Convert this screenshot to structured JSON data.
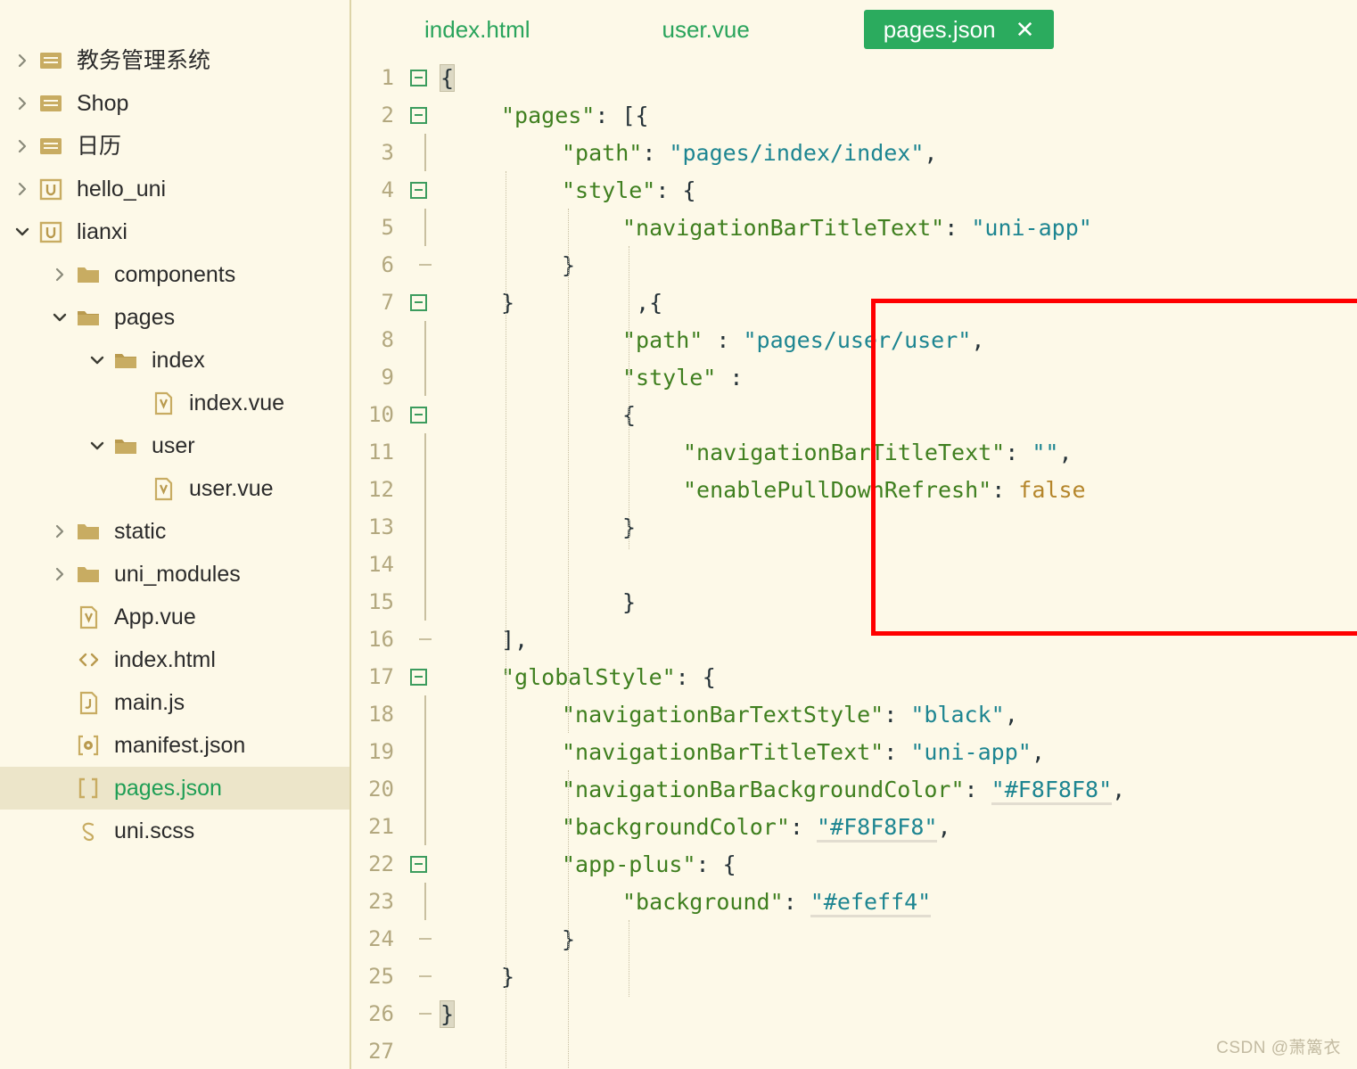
{
  "theme": {
    "background": "#fdf9e8",
    "accent_green": "#2bab5e",
    "selected_row": "#ece5c9",
    "key_color": "#3f7f1f",
    "string_color": "#1d8591",
    "boolean_color": "#b5862b",
    "line_number_color": "#b3a87f",
    "annotation_box_color": "#ff0000",
    "divider_color": "#ddd4a8"
  },
  "sidebar": {
    "items": [
      {
        "label": "教务管理系统",
        "icon": "folder-closed-icon",
        "twisty": "chevron-right",
        "depth": 0,
        "selected": false
      },
      {
        "label": "Shop",
        "icon": "folder-closed-icon",
        "twisty": "chevron-right",
        "depth": 0,
        "selected": false
      },
      {
        "label": "日历",
        "icon": "folder-closed-icon",
        "twisty": "chevron-right",
        "depth": 0,
        "selected": false
      },
      {
        "label": "hello_uni",
        "icon": "uniapp-project-icon",
        "twisty": "chevron-right",
        "depth": 0,
        "selected": false
      },
      {
        "label": "lianxi",
        "icon": "uniapp-project-icon",
        "twisty": "chevron-down",
        "depth": 0,
        "selected": false
      },
      {
        "label": "components",
        "icon": "folder-icon",
        "twisty": "chevron-right",
        "depth": 1,
        "selected": false
      },
      {
        "label": "pages",
        "icon": "folder-open-icon",
        "twisty": "chevron-down",
        "depth": 1,
        "selected": false
      },
      {
        "label": "index",
        "icon": "folder-open-icon",
        "twisty": "chevron-down",
        "depth": 2,
        "selected": false
      },
      {
        "label": "index.vue",
        "icon": "vue-file-icon",
        "twisty": "none",
        "depth": 3,
        "selected": false
      },
      {
        "label": "user",
        "icon": "folder-open-icon",
        "twisty": "chevron-down",
        "depth": 2,
        "selected": false
      },
      {
        "label": "user.vue",
        "icon": "vue-file-icon",
        "twisty": "none",
        "depth": 3,
        "selected": false
      },
      {
        "label": "static",
        "icon": "folder-icon",
        "twisty": "chevron-right",
        "depth": 1,
        "selected": false
      },
      {
        "label": "uni_modules",
        "icon": "folder-icon",
        "twisty": "chevron-right",
        "depth": 1,
        "selected": false
      },
      {
        "label": "App.vue",
        "icon": "vue-file-icon",
        "twisty": "none",
        "depth": 1,
        "selected": false
      },
      {
        "label": "index.html",
        "icon": "html-file-icon",
        "twisty": "none",
        "depth": 1,
        "selected": false
      },
      {
        "label": "main.js",
        "icon": "js-file-icon",
        "twisty": "none",
        "depth": 1,
        "selected": false
      },
      {
        "label": "manifest.json",
        "icon": "manifest-file-icon",
        "twisty": "none",
        "depth": 1,
        "selected": false
      },
      {
        "label": "pages.json",
        "icon": "json-file-icon",
        "twisty": "none",
        "depth": 1,
        "selected": true
      },
      {
        "label": "uni.scss",
        "icon": "scss-file-icon",
        "twisty": "none",
        "depth": 1,
        "selected": false
      }
    ]
  },
  "tabs": [
    {
      "label": "index.html",
      "active": false,
      "closable": false
    },
    {
      "label": "user.vue",
      "active": false,
      "closable": false
    },
    {
      "label": "pages.json",
      "active": true,
      "closable": true,
      "close_label": "✕"
    }
  ],
  "editor": {
    "language": "json",
    "filename": "pages.json",
    "lines": [
      {
        "n": "1",
        "fold": "box",
        "indent": 0,
        "tokens": [
          {
            "t": "{",
            "c": "p",
            "hl": true
          }
        ]
      },
      {
        "n": "2",
        "fold": "box",
        "indent": 1,
        "tokens": [
          {
            "t": "\"pages\"",
            "c": "k"
          },
          {
            "t": ": [{",
            "c": "p"
          }
        ]
      },
      {
        "n": "3",
        "fold": "bar",
        "indent": 2,
        "tokens": [
          {
            "t": "\"path\"",
            "c": "k"
          },
          {
            "t": ": ",
            "c": "p"
          },
          {
            "t": "\"pages/index/index\"",
            "c": "s"
          },
          {
            "t": ",",
            "c": "p"
          }
        ]
      },
      {
        "n": "4",
        "fold": "box",
        "indent": 2,
        "tokens": [
          {
            "t": "\"style\"",
            "c": "k"
          },
          {
            "t": ": {",
            "c": "p"
          }
        ]
      },
      {
        "n": "5",
        "fold": "bar",
        "indent": 3,
        "tokens": [
          {
            "t": "\"navigationBarTitleText\"",
            "c": "k"
          },
          {
            "t": ": ",
            "c": "p"
          },
          {
            "t": "\"uni-app\"",
            "c": "s"
          }
        ]
      },
      {
        "n": "6",
        "fold": "end",
        "indent": 2,
        "tokens": [
          {
            "t": "}",
            "c": "p"
          }
        ]
      },
      {
        "n": "7",
        "fold": "box",
        "indent": 1,
        "tokens": [
          {
            "t": "}",
            "c": "p"
          }
        ]
      },
      {
        "n": "8",
        "fold": "bar",
        "indent": 0,
        "tokens": []
      },
      {
        "n": "9",
        "fold": "bar",
        "indent": 0,
        "tokens": []
      },
      {
        "n": "10",
        "fold": "box",
        "indent": 0,
        "tokens": []
      },
      {
        "n": "11",
        "fold": "bar",
        "indent": 0,
        "tokens": []
      },
      {
        "n": "12",
        "fold": "bar",
        "indent": 0,
        "tokens": []
      },
      {
        "n": "13",
        "fold": "bar",
        "indent": 0,
        "tokens": []
      },
      {
        "n": "14",
        "fold": "bar",
        "indent": 0,
        "tokens": []
      },
      {
        "n": "15",
        "fold": "bar",
        "indent": 0,
        "tokens": []
      },
      {
        "n": "16",
        "fold": "end",
        "indent": 1,
        "tokens": [
          {
            "t": "],",
            "c": "p"
          }
        ]
      },
      {
        "n": "17",
        "fold": "box",
        "indent": 1,
        "tokens": [
          {
            "t": "\"globalStyle\"",
            "c": "k"
          },
          {
            "t": ": {",
            "c": "p"
          }
        ]
      },
      {
        "n": "18",
        "fold": "bar",
        "indent": 2,
        "tokens": [
          {
            "t": "\"navigationBarTextStyle\"",
            "c": "k"
          },
          {
            "t": ": ",
            "c": "p"
          },
          {
            "t": "\"black\"",
            "c": "s"
          },
          {
            "t": ",",
            "c": "p"
          }
        ]
      },
      {
        "n": "19",
        "fold": "bar",
        "indent": 2,
        "tokens": [
          {
            "t": "\"navigationBarTitleText\"",
            "c": "k"
          },
          {
            "t": ": ",
            "c": "p"
          },
          {
            "t": "\"uni-app\"",
            "c": "s"
          },
          {
            "t": ",",
            "c": "p"
          }
        ]
      },
      {
        "n": "20",
        "fold": "bar",
        "indent": 2,
        "tokens": [
          {
            "t": "\"navigationBarBackgroundColor\"",
            "c": "k"
          },
          {
            "t": ": ",
            "c": "p"
          },
          {
            "t": "\"#F8F8F8\"",
            "c": "hexv"
          },
          {
            "t": ",",
            "c": "p"
          }
        ]
      },
      {
        "n": "21",
        "fold": "bar",
        "indent": 2,
        "tokens": [
          {
            "t": "\"backgroundColor\"",
            "c": "k"
          },
          {
            "t": ": ",
            "c": "p"
          },
          {
            "t": "\"#F8F8F8\"",
            "c": "hexv"
          },
          {
            "t": ",",
            "c": "p"
          }
        ]
      },
      {
        "n": "22",
        "fold": "box",
        "indent": 2,
        "tokens": [
          {
            "t": "\"app-plus\"",
            "c": "k"
          },
          {
            "t": ": {",
            "c": "p"
          }
        ]
      },
      {
        "n": "23",
        "fold": "bar",
        "indent": 3,
        "tokens": [
          {
            "t": "\"background\"",
            "c": "k"
          },
          {
            "t": ": ",
            "c": "p"
          },
          {
            "t": "\"#efeff4\"",
            "c": "hexv"
          }
        ]
      },
      {
        "n": "24",
        "fold": "end",
        "indent": 2,
        "tokens": [
          {
            "t": "}",
            "c": "p"
          }
        ]
      },
      {
        "n": "25",
        "fold": "end",
        "indent": 1,
        "tokens": [
          {
            "t": "}",
            "c": "p"
          }
        ]
      },
      {
        "n": "26",
        "fold": "end",
        "indent": 0,
        "tokens": [
          {
            "t": "}",
            "c": "p",
            "hl": true
          }
        ]
      },
      {
        "n": "27",
        "fold": "none",
        "indent": 0,
        "tokens": []
      }
    ],
    "highlighted_block": {
      "lines": [
        {
          "n": "7",
          "indent": 2,
          "tokens": [
            {
              "t": ",{",
              "c": "p"
            }
          ]
        },
        {
          "n": "8",
          "indent": 3,
          "tokens": [
            {
              "t": "\"path\"",
              "c": "k"
            },
            {
              "t": " : ",
              "c": "p"
            },
            {
              "t": "\"pages/user/user\"",
              "c": "s"
            },
            {
              "t": ",",
              "c": "p"
            }
          ]
        },
        {
          "n": "9",
          "indent": 3,
          "tokens": [
            {
              "t": "\"style\"",
              "c": "k"
            },
            {
              "t": " :",
              "c": "p"
            }
          ]
        },
        {
          "n": "10",
          "indent": 3,
          "tokens": [
            {
              "t": "{",
              "c": "p"
            }
          ]
        },
        {
          "n": "11",
          "indent": 4,
          "tokens": [
            {
              "t": "\"navigationBarTitleText\"",
              "c": "k"
            },
            {
              "t": ": ",
              "c": "p"
            },
            {
              "t": "\"\"",
              "c": "s"
            },
            {
              "t": ",",
              "c": "p"
            }
          ]
        },
        {
          "n": "12",
          "indent": 4,
          "tokens": [
            {
              "t": "\"enablePullDownRefresh\"",
              "c": "k"
            },
            {
              "t": ": ",
              "c": "p"
            },
            {
              "t": "false",
              "c": "b"
            }
          ]
        },
        {
          "n": "13",
          "indent": 3,
          "tokens": [
            {
              "t": "}",
              "c": "p"
            }
          ]
        },
        {
          "n": "14",
          "indent": 0,
          "tokens": []
        },
        {
          "n": "15",
          "indent": 3,
          "tokens": [
            {
              "t": "}",
              "c": "p"
            }
          ]
        }
      ]
    }
  },
  "collapse_handle": {
    "icon": "chevron-left-icon",
    "label": "‹"
  },
  "watermark": {
    "text": "CSDN @萧篱衣"
  }
}
